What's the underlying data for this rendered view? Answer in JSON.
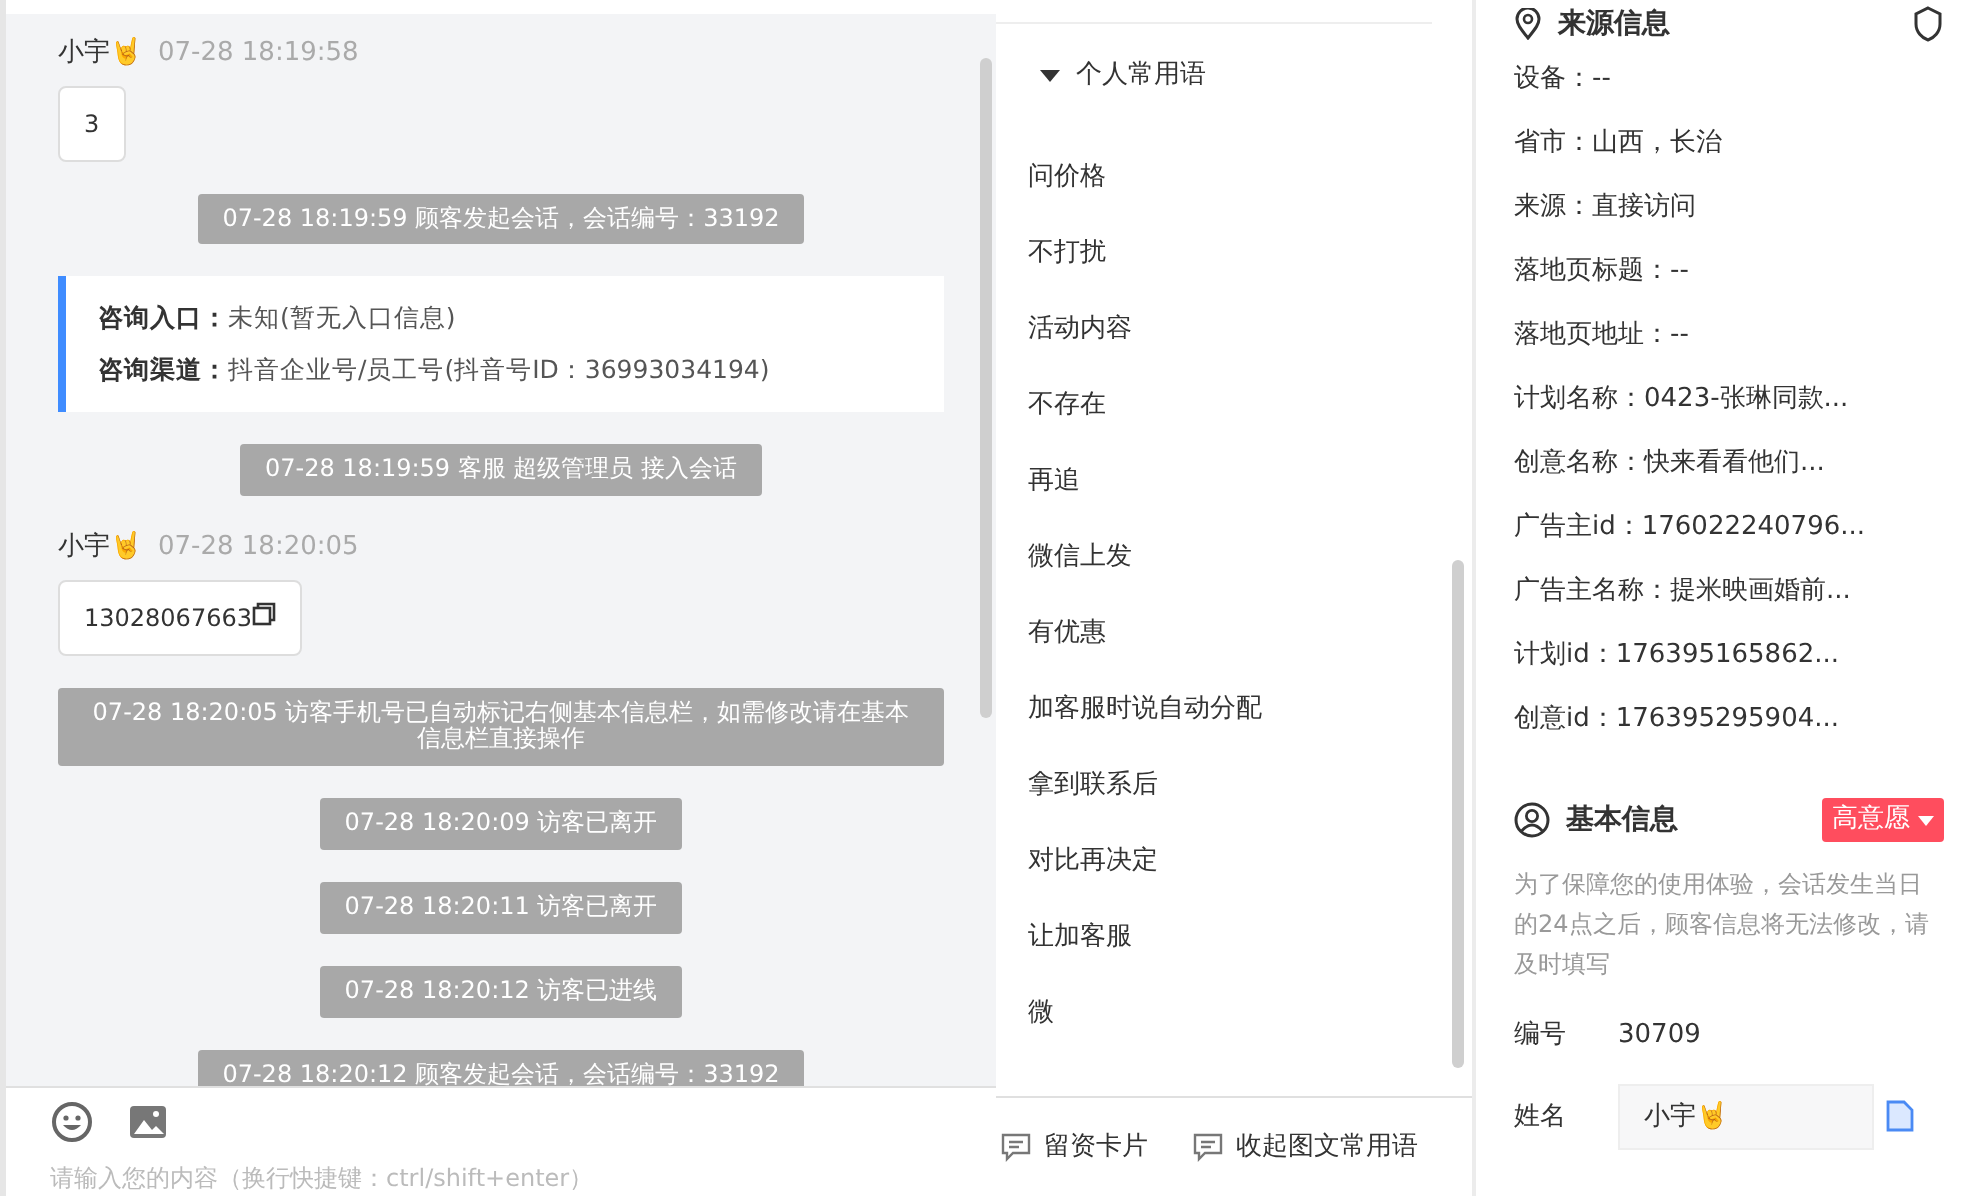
{
  "chat": {
    "messages": [
      {
        "kind": "visitor",
        "sender": "小宇🤘",
        "time": "07-28 18:19:58",
        "text": "3",
        "copyable": false
      },
      {
        "kind": "system",
        "text": "07-28 18:19:59 顾客发起会话，会话编号：33192"
      },
      {
        "kind": "info",
        "lines": [
          {
            "label": "咨询入口：",
            "value": "未知(暂无入口信息)"
          },
          {
            "label": "咨询渠道：",
            "value": "抖音企业号/员工号(抖音号ID：36993034194)"
          }
        ]
      },
      {
        "kind": "system",
        "text": "07-28 18:19:59 客服 超级管理员 接入会话"
      },
      {
        "kind": "visitor",
        "sender": "小宇🤘",
        "time": "07-28 18:20:05",
        "text": "13028067663",
        "copyable": true
      },
      {
        "kind": "system",
        "text": "07-28 18:20:05 访客手机号已自动标记右侧基本信息栏，如需修改请在基本信息栏直接操作"
      },
      {
        "kind": "system",
        "text": "07-28 18:20:09 访客已离开"
      },
      {
        "kind": "system",
        "text": "07-28 18:20:11 访客已离开"
      },
      {
        "kind": "system",
        "text": "07-28 18:20:12 访客已进线"
      },
      {
        "kind": "system",
        "text": "07-28 18:20:12 顾客发起会话，会话编号：33192"
      }
    ],
    "input": {
      "placeholder": "请输入您的内容（换行快捷键：ctrl/shift+enter）"
    }
  },
  "phrases": {
    "group": {
      "title": "个人常用语",
      "expanded": true
    },
    "items": [
      "问价格",
      "不打扰",
      "活动内容",
      "不存在",
      "再追",
      "微信上发",
      "有优惠",
      "加客服时说自动分配",
      "拿到联系后",
      "对比再决定",
      "让加客服",
      "微"
    ],
    "toolbar": [
      "留资卡片",
      "收起图文常用语"
    ]
  },
  "source_info": {
    "title": "来源信息",
    "fields": [
      "设备：--",
      "省市：山西，长治",
      "来源：直接访问",
      "落地页标题：--",
      "落地页地址：--",
      "计划名称：0423-张琳同款...",
      "创意名称：快来看看他们...",
      "广告主id：176022240796...",
      "广告主名称：提米映画婚前...",
      "计划id：176395165862...",
      "创意id：176395295904..."
    ]
  },
  "basic_info": {
    "title": "基本信息",
    "intent": "高意愿",
    "note": "为了保障您的使用体验，会话发生当日的24点之后，顾客信息将无法修改，请及时填写",
    "fields": [
      {
        "kind": "text",
        "label": "编号",
        "value": "30709"
      },
      {
        "kind": "input",
        "label": "姓名",
        "value": "小宇🤘"
      }
    ]
  }
}
